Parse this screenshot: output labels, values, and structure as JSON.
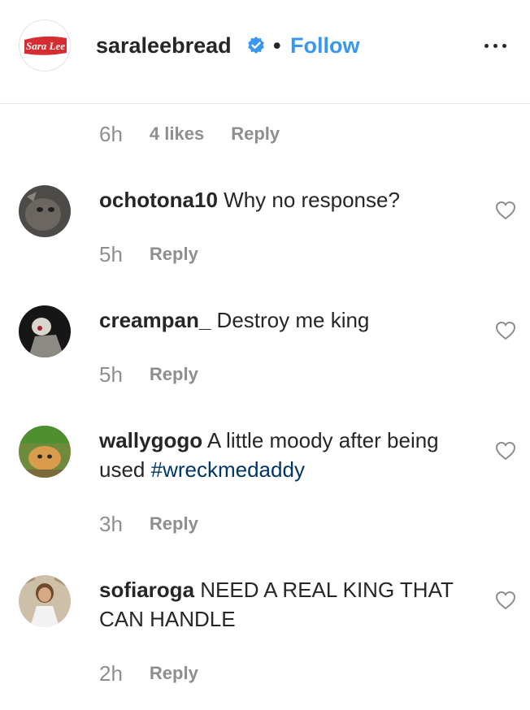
{
  "header": {
    "logo_text": "Sara Lee",
    "username": "saraleebread",
    "separator": "•",
    "follow_label": "Follow"
  },
  "top_meta": {
    "time": "6h",
    "likes": "4 likes",
    "reply": "Reply"
  },
  "comments": [
    {
      "user": "ochotona10",
      "text": "Why no response?",
      "hashtag": "",
      "time": "5h",
      "reply": "Reply"
    },
    {
      "user": "creampan_",
      "text": "Destroy me king",
      "hashtag": "",
      "time": "5h",
      "reply": "Reply"
    },
    {
      "user": "wallygogo",
      "text": "A little moody after being used",
      "hashtag": "#wreckmedaddy",
      "time": "3h",
      "reply": "Reply"
    },
    {
      "user": "sofiaroga",
      "text": "NEED A REAL KING THAT CAN HANDLE",
      "hashtag": "",
      "time": "2h",
      "reply": "Reply"
    }
  ],
  "colors": {
    "follow": "#3897f0",
    "hashtag": "#003569",
    "verified": "#3897f0",
    "logo_red": "#d62d32"
  }
}
